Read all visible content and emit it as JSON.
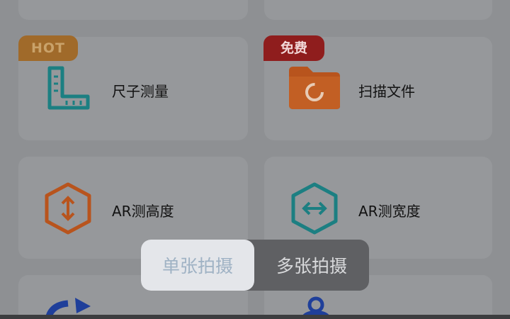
{
  "tools": {
    "ruler": {
      "label": "尺子测量",
      "badge": "HOT",
      "icon": "ruler-icon"
    },
    "scan": {
      "label": "扫描文件",
      "badge": "免费",
      "icon": "folder-scan-icon"
    },
    "ar_height": {
      "label": "AR测高度",
      "icon": "ar-height-icon"
    },
    "ar_width": {
      "label": "AR测宽度",
      "icon": "ar-width-icon"
    }
  },
  "capture_mode": {
    "single": "单张拍摄",
    "multi": "多张拍摄",
    "selected": "single"
  },
  "colors": {
    "hot_badge": "#a06a2a",
    "free_badge": "#8f1d1d",
    "teal_icon": "#1c7f82",
    "orange_icon": "#b8541d",
    "blue_icon": "#1f3f9a"
  }
}
